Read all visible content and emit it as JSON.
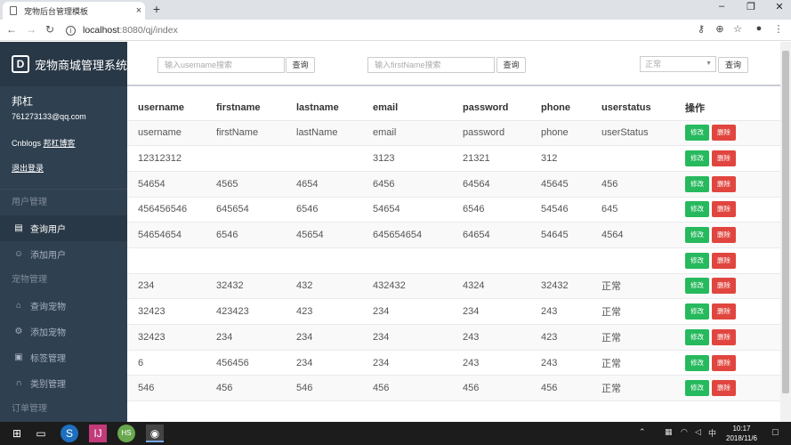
{
  "browser": {
    "tab_title": "宠物后台管理模板",
    "tab_close": "×",
    "new_tab": "+",
    "url_host": "localhost",
    "url_path": ":8080/qj/index",
    "win_min": "–",
    "win_max": "❐",
    "win_close": "✕"
  },
  "sidebar": {
    "brand_logo": "D",
    "brand": "宠物商城管理系统",
    "user_name": "邦杠",
    "user_email": "761273133@qq.com",
    "blog_prefix": "Cnblogs",
    "blog_link": "邦杠博客",
    "logout": "退出登录",
    "section_user": "用户管理",
    "item_query_user": "查询用户",
    "item_add_user": "添加用户",
    "section_pet": "宠物管理",
    "item_query_pet": "查询宠物",
    "item_add_pet": "添加宠物",
    "item_tags": "标签管理",
    "item_category": "类别管理",
    "section_order": "订单管理"
  },
  "filters": {
    "username_placeholder": "输入username搜索",
    "firstname_placeholder": "输入firstName搜索",
    "status_value": "正常",
    "query_label": "查询"
  },
  "table": {
    "headers": [
      "username",
      "firstname",
      "lastname",
      "email",
      "password",
      "phone",
      "userstatus",
      "操作"
    ],
    "edit_label": "修改",
    "delete_label": "删除",
    "rows": [
      [
        "username",
        "firstName",
        "lastName",
        "email",
        "password",
        "phone",
        "userStatus"
      ],
      [
        "12312312",
        "",
        "",
        "3123",
        "21321",
        "312",
        ""
      ],
      [
        "54654",
        "4565",
        "4654",
        "6456",
        "64564",
        "45645",
        "456"
      ],
      [
        "456456546",
        "645654",
        "6546",
        "54654",
        "6546",
        "54546",
        "645"
      ],
      [
        "54654654",
        "6546",
        "45654",
        "645654654",
        "64654",
        "54645",
        "4564"
      ],
      [
        "",
        "",
        "",
        "",
        "",
        "",
        ""
      ],
      [
        "234",
        "32432",
        "432",
        "432432",
        "4324",
        "32432",
        "正常"
      ],
      [
        "32423",
        "423423",
        "423",
        "234",
        "234",
        "243",
        "正常"
      ],
      [
        "32423",
        "234",
        "234",
        "234",
        "243",
        "423",
        "正常"
      ],
      [
        "6",
        "456456",
        "234",
        "234",
        "243",
        "243",
        "正常"
      ],
      [
        "546",
        "456",
        "546",
        "456",
        "456",
        "456",
        "正常"
      ]
    ]
  },
  "taskbar": {
    "time": "10:17",
    "date": "2018/11/6",
    "ime": "中"
  }
}
